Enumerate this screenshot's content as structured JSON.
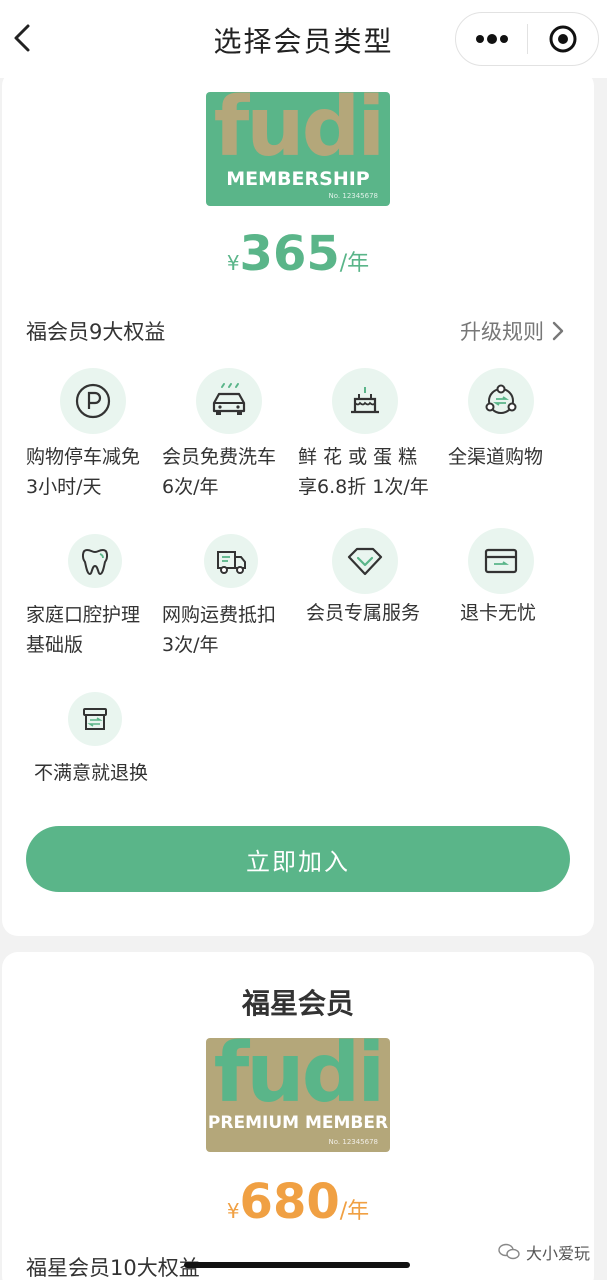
{
  "navbar": {
    "title": "选择会员类型",
    "back_icon": "chevron-left-icon",
    "more_icon": "more-dots-icon",
    "close_icon": "target-circle-icon"
  },
  "plan1": {
    "card_logo": "fudi",
    "card_subtitle": "MEMBERSHIP",
    "card_number": "No. 12345678",
    "price_symbol": "¥",
    "price_value": "365",
    "price_unit": "/年",
    "benefits_title": "福会员9大权益",
    "upgrade_link": "升级规则",
    "benefits": [
      {
        "icon": "parking-icon",
        "line1": "购物停车减免",
        "line2": "3小时/天"
      },
      {
        "icon": "car-wash-icon",
        "line1": "会员免费洗车",
        "line2": "6次/年"
      },
      {
        "icon": "cake-icon",
        "line1": "鲜 花 或 蛋 糕",
        "line2": "享6.8折 1次/年"
      },
      {
        "icon": "omnichannel-icon",
        "line1": "全渠道购物",
        "line2": ""
      },
      {
        "icon": "tooth-icon",
        "line1": "家庭口腔护理",
        "line2": "基础版"
      },
      {
        "icon": "delivery-truck-icon",
        "line1": "网购运费抵扣",
        "line2": "3次/年"
      },
      {
        "icon": "diamond-icon",
        "line1": "会员专属服务",
        "line2": ""
      },
      {
        "icon": "card-icon",
        "line1": "退卡无忧",
        "line2": ""
      },
      {
        "icon": "exchange-box-icon",
        "line1": "不满意就退换",
        "line2": ""
      }
    ],
    "join_button": "立即加入"
  },
  "plan2": {
    "title": "福星会员",
    "card_logo": "fudi",
    "card_subtitle": "PREMIUM MEMBER",
    "card_number": "No. 12345678",
    "price_symbol": "¥",
    "price_value": "680",
    "price_unit": "/年",
    "benefits_title": "福星会员10大权益"
  },
  "watermark": {
    "text": "大小爱玩",
    "icon": "wechat-icon"
  },
  "colors": {
    "green": "#5ab589",
    "gold": "#b4a77a",
    "orange": "#f0a043",
    "icon_bg": "#e9f5ef"
  }
}
